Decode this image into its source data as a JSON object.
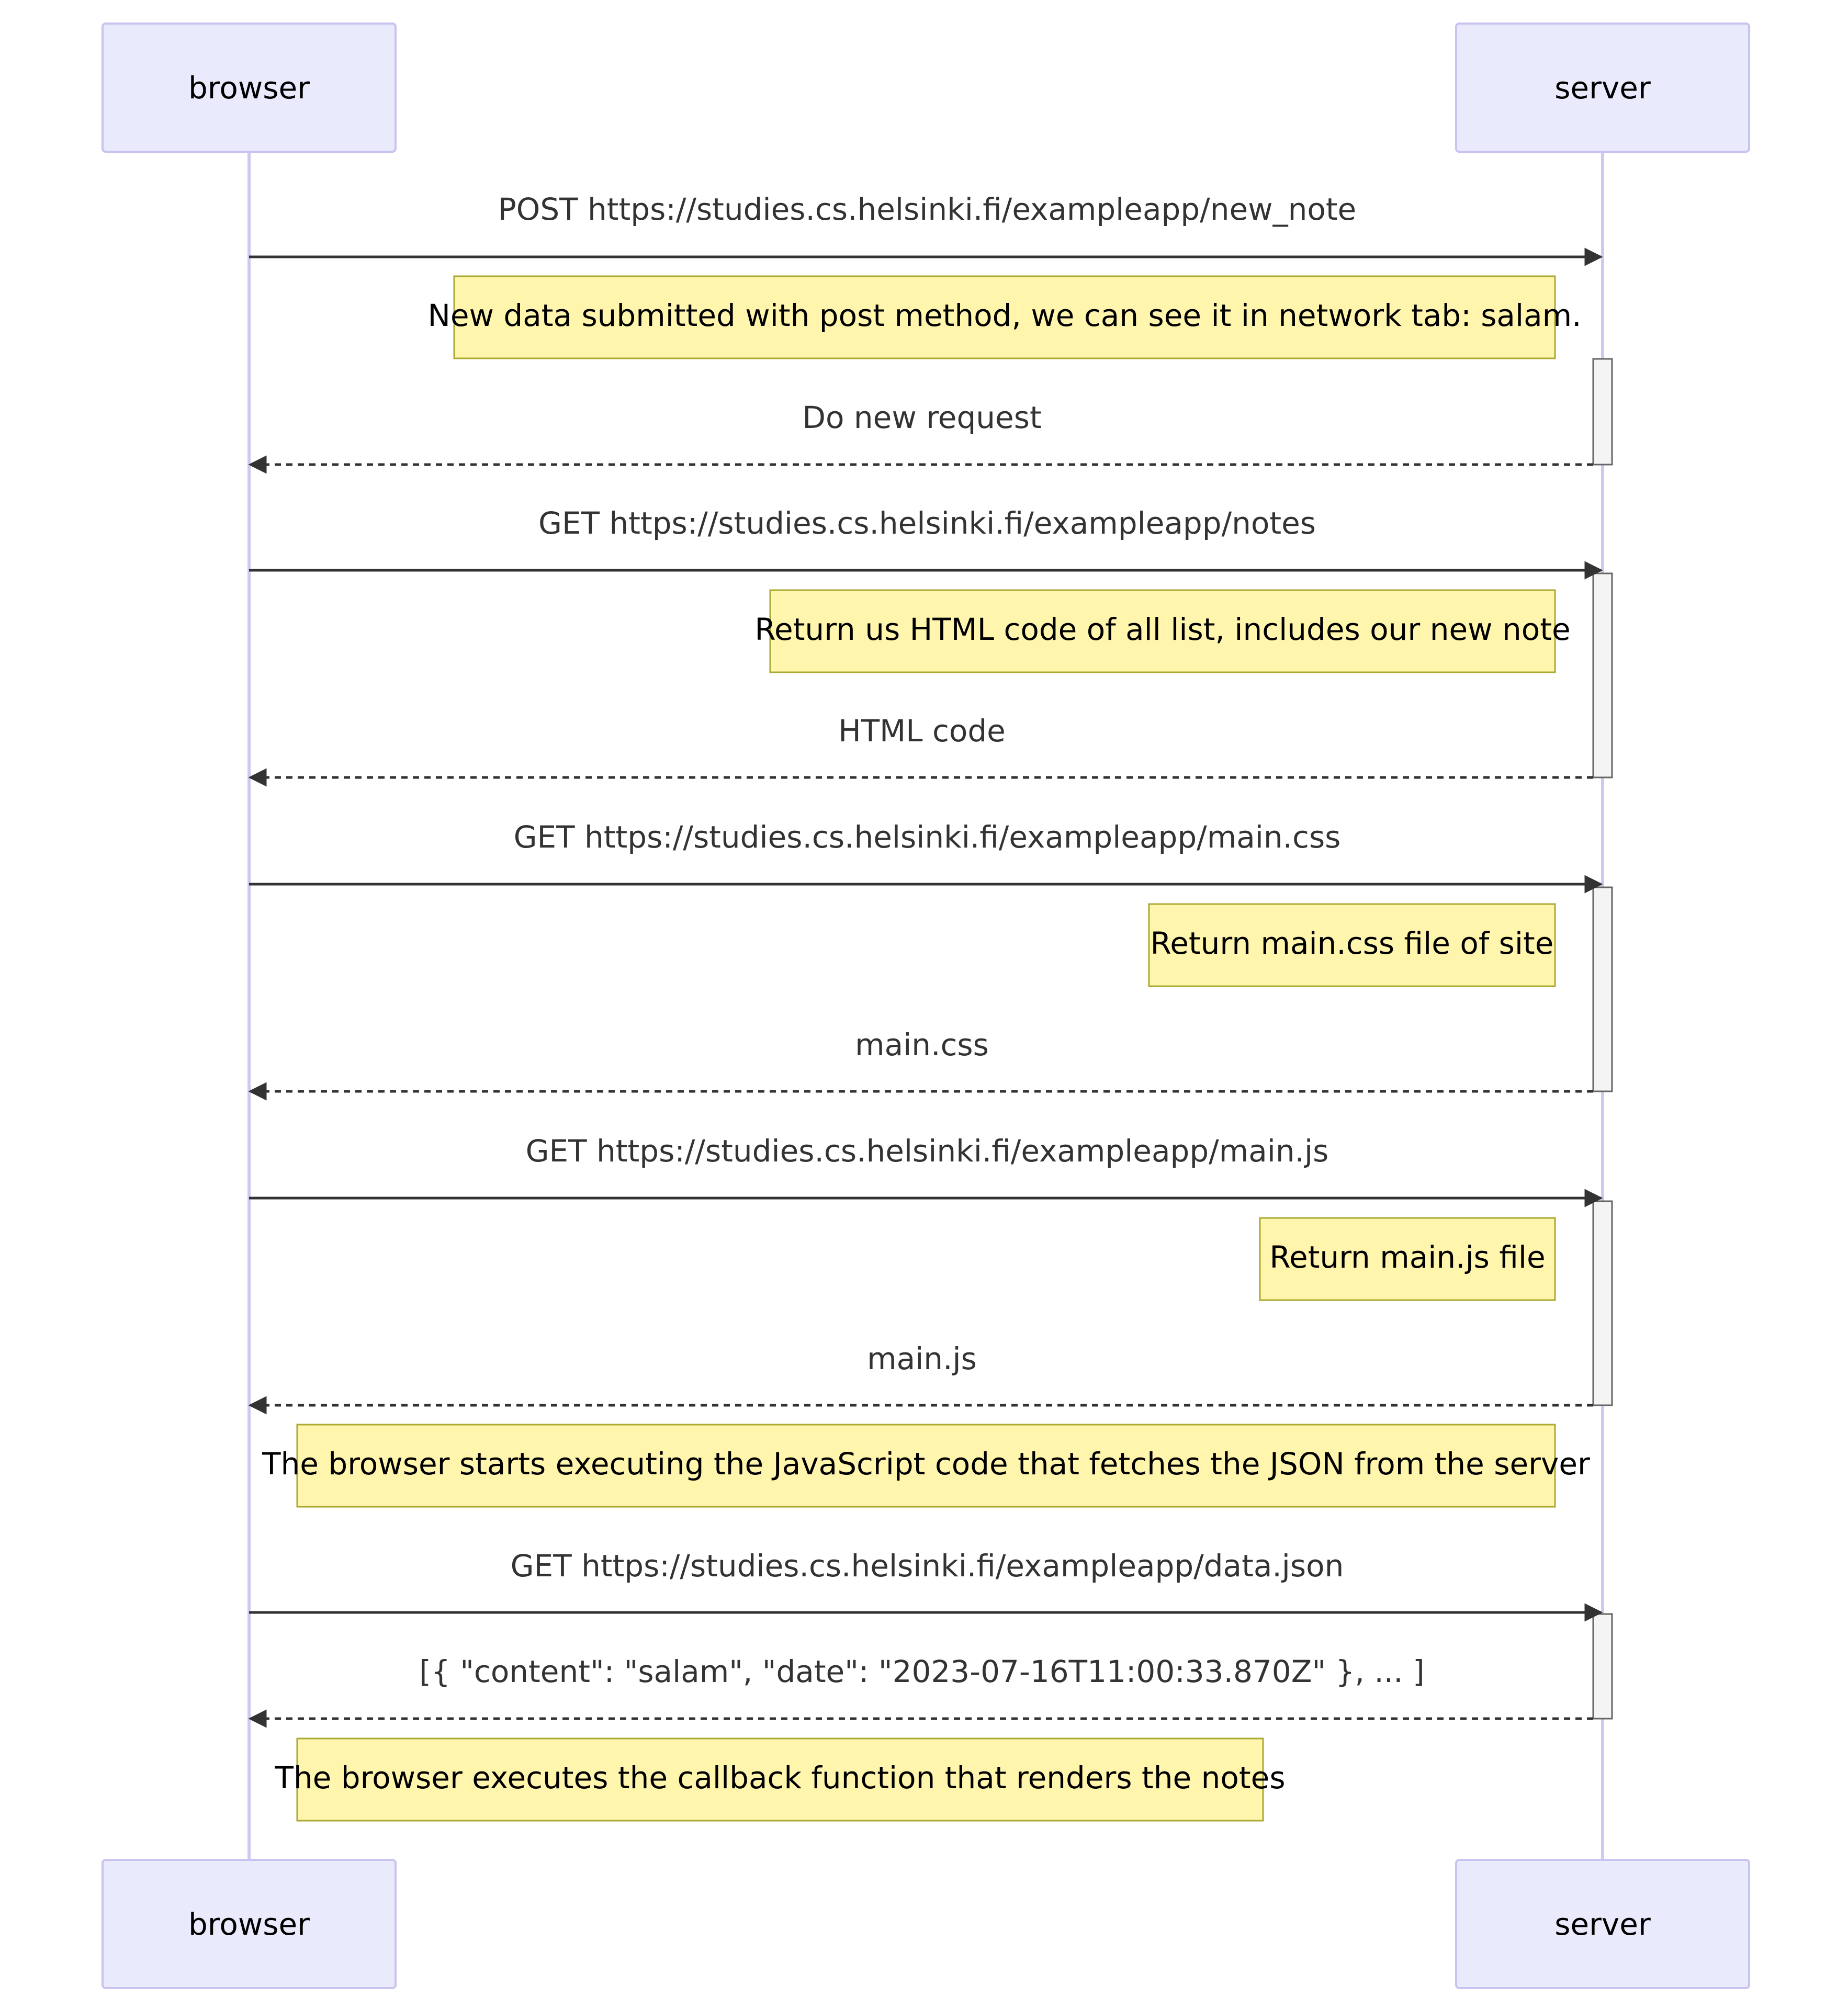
{
  "participants": {
    "left": "browser",
    "right": "server"
  },
  "messages": [
    {
      "text": "POST https://studies.cs.helsinki.fi/exampleapp/new_note",
      "direction": "request"
    },
    {
      "text": "Do new request",
      "direction": "response"
    },
    {
      "text": "GET https://studies.cs.helsinki.fi/exampleapp/notes",
      "direction": "request"
    },
    {
      "text": "HTML code",
      "direction": "response"
    },
    {
      "text": "GET https://studies.cs.helsinki.fi/exampleapp/main.css",
      "direction": "request"
    },
    {
      "text": "main.css",
      "direction": "response"
    },
    {
      "text": "GET https://studies.cs.helsinki.fi/exampleapp/main.js",
      "direction": "request"
    },
    {
      "text": "main.js",
      "direction": "response"
    },
    {
      "text": "GET https://studies.cs.helsinki.fi/exampleapp/data.json",
      "direction": "request"
    },
    {
      "text": "[{ \"content\": \"salam\", \"date\": \"2023-07-16T11:00:33.870Z\" }, ... ]",
      "direction": "response"
    }
  ],
  "notes": [
    {
      "text": "New data submitted with post method, we can see it in network tab: salam.",
      "position": "left of server"
    },
    {
      "text": "Return us HTML code of all list, includes our new note",
      "position": "left of server"
    },
    {
      "text": "Return main.css file of site",
      "position": "left of server"
    },
    {
      "text": "Return main.js file",
      "position": "left of server"
    },
    {
      "text": "The browser starts executing the JavaScript code that fetches the JSON from the server",
      "position": "right of browser"
    },
    {
      "text": "The browser executes the callback function that renders the notes",
      "position": "right of browser"
    }
  ],
  "colors": {
    "actor_fill": "#eaeafd",
    "actor_border": "#c9c3ef",
    "lifeline": "#d0c8f2",
    "note_fill": "#fff5ad",
    "note_border": "#aaaa33",
    "activation_fill": "#f4f4f4",
    "activation_border": "#666666",
    "arrow": "#333333"
  }
}
